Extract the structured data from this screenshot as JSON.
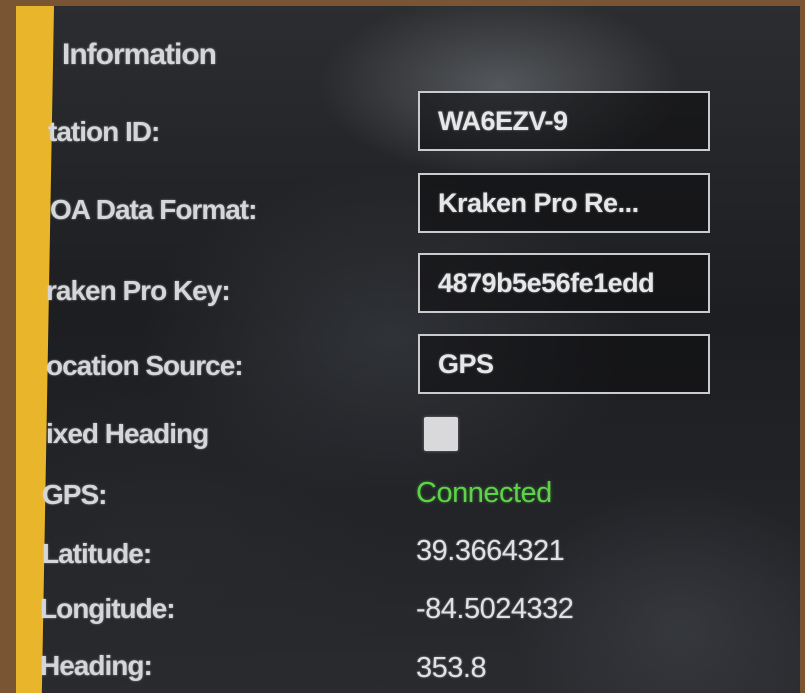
{
  "section": {
    "title": "Information"
  },
  "form": {
    "station_id": {
      "label": "tation ID:",
      "value": "WA6EZV-9"
    },
    "doa_format": {
      "label": "OA Data Format:",
      "value": "Kraken Pro Re..."
    },
    "kraken_key": {
      "label": "raken Pro Key:",
      "value": "4879b5e56fe1edd"
    },
    "location_source": {
      "label": "ocation Source:",
      "value": "GPS"
    },
    "fixed_heading": {
      "label": "ixed Heading",
      "checked": false
    }
  },
  "status": {
    "gps": {
      "label": "GPS:",
      "value": "Connected",
      "color": "#5ed34a"
    },
    "latitude": {
      "label": "Latitude:",
      "value": "39.3664321"
    },
    "longitude": {
      "label": "Longitude:",
      "value": "-84.5024332"
    },
    "heading": {
      "label": "Heading:",
      "value": "353.8"
    }
  },
  "colors": {
    "frame": "#7a5534",
    "accent_strip": "#e9b52a",
    "connected": "#5ed34a"
  }
}
